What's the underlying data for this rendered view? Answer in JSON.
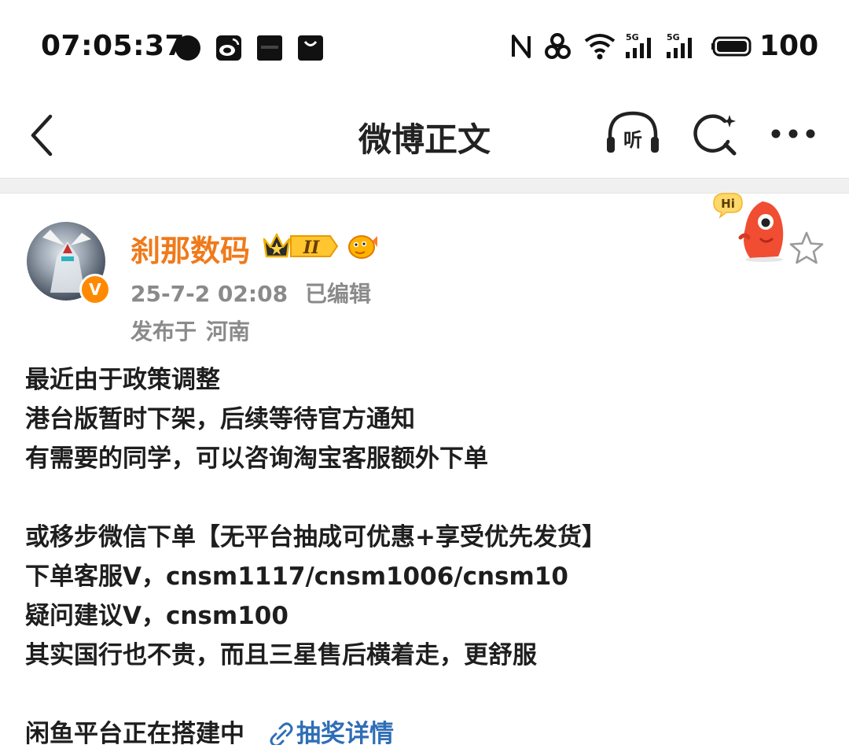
{
  "status_bar": {
    "time": "07:05:37",
    "battery": "100",
    "signal_label_1": "5G",
    "signal_label_2": "5G"
  },
  "nav": {
    "title": "微博正文",
    "listen_label": "听"
  },
  "post": {
    "username": "刹那数码",
    "rank_badge": "II",
    "verify_mark": "V",
    "hi_bubble": "Hi",
    "date": "25-7-2 02:08",
    "edited": "已编辑",
    "location_prefix": "发布于",
    "location": "河南",
    "lines": [
      "最近由于政策调整",
      "港台版暂时下架，后续等待官方通知",
      "有需要的同学，可以咨询淘宝客服额外下单",
      "",
      "或移步微信下单【无平台抽成可优惠+享受优先发货】",
      "下单客服V，cnsm1117/cnsm1006/cnsm10",
      "疑问建议V，cnsm100",
      "其实国行也不贵，而且三星售后横着走，更舒服",
      ""
    ],
    "last_line_text": "闲鱼平台正在搭建中",
    "lottery_link": "抽奖详情"
  },
  "colors": {
    "username": "#f07a1a",
    "link": "#2f6eb6",
    "meta": "#8a8a8a",
    "divider": "#f0f0f0"
  },
  "icons": {
    "back": "back-arrow-icon",
    "listen": "headphones-icon",
    "search": "search-icon",
    "more": "more-dots-icon",
    "star": "star-icon"
  }
}
